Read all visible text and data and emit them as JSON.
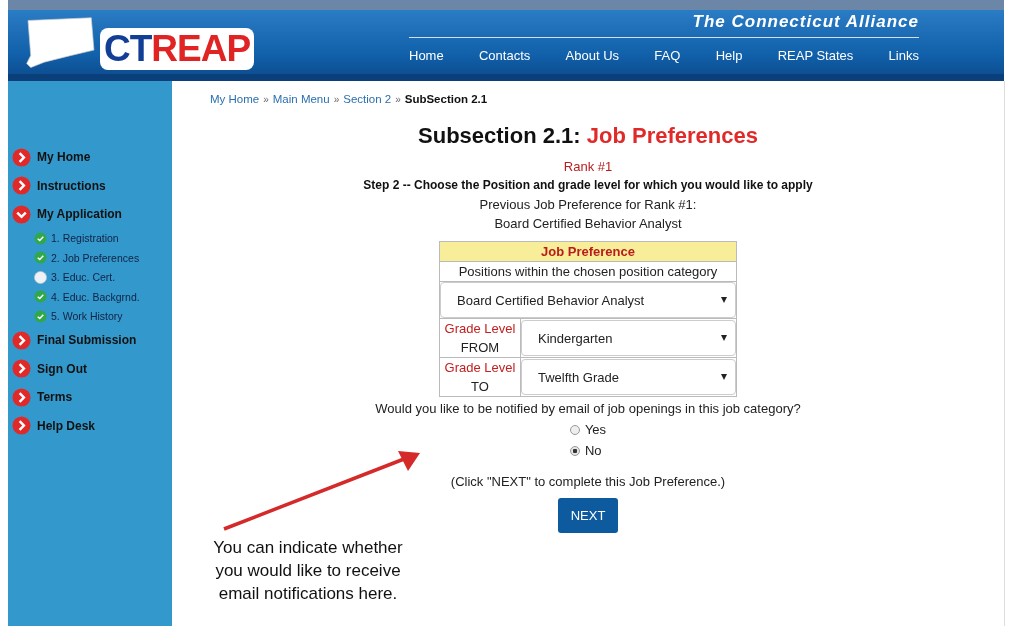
{
  "header": {
    "logo": {
      "part_1": "CT",
      "part_2": "REAP"
    },
    "tagline": "The Connecticut Alliance",
    "nav": [
      "Home",
      "Contacts",
      "About Us",
      "FAQ",
      "Help",
      "REAP States",
      "Links"
    ]
  },
  "sidebar": {
    "items": [
      {
        "label": "My Home",
        "expanded": false
      },
      {
        "label": "Instructions",
        "expanded": false
      },
      {
        "label": "My Application",
        "expanded": true,
        "children": [
          {
            "label": "1. Registration",
            "completed": true
          },
          {
            "label": "2. Job Preferences",
            "completed": true
          },
          {
            "label": "3. Educ. Cert.",
            "completed": false
          },
          {
            "label": "4. Educ. Backgrnd.",
            "completed": true
          },
          {
            "label": "5. Work History",
            "completed": true
          }
        ]
      },
      {
        "label": "Final Submission",
        "expanded": false
      },
      {
        "label": "Sign Out",
        "expanded": false
      },
      {
        "label": "Terms",
        "expanded": false
      },
      {
        "label": "Help Desk",
        "expanded": false
      }
    ]
  },
  "breadcrumb": {
    "links": [
      "My Home",
      "Main Menu",
      "Section 2"
    ],
    "separator": "»",
    "current": "SubSection 2.1"
  },
  "title": {
    "prefix": "Subsection 2.1:",
    "highlight": "Job Preferences"
  },
  "rank": "Rank #1",
  "step": "Step 2 -- Choose the Position and grade level for which you would like to apply",
  "previous": {
    "label": "Previous Job Preference for Rank #1:",
    "value": "Board Certified Behavior Analyst"
  },
  "job_preference": {
    "heading": "Job Preference",
    "subheading": "Positions within the chosen position category",
    "position": "Board Certified Behavior Analyst",
    "grades": [
      {
        "label": "Grade Level",
        "sublabel": "FROM",
        "value": "Kindergarten"
      },
      {
        "label": "Grade Level",
        "sublabel": "TO",
        "value": "Twelfth Grade"
      }
    ]
  },
  "notify": {
    "question": "Would you like to be notified by email of job openings in this job category?",
    "options": [
      {
        "label": "Yes",
        "selected": false
      },
      {
        "label": "No",
        "selected": true
      }
    ]
  },
  "hint": "(Click \"NEXT\" to complete this Job Preference.)",
  "next_button": "NEXT",
  "callout": "You can indicate whether you would like to receive email notifications here."
}
